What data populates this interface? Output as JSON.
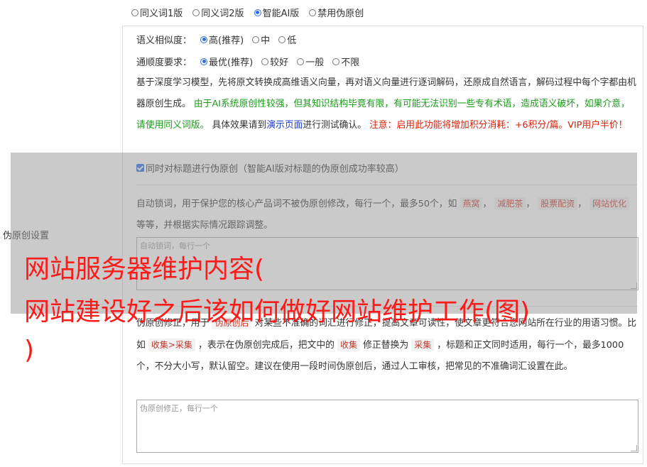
{
  "top_radios": [
    {
      "label": "同义词1版",
      "checked": false
    },
    {
      "label": "同义词2版",
      "checked": false
    },
    {
      "label": "智能AI版",
      "checked": true
    },
    {
      "label": "禁用伪原创",
      "checked": false
    }
  ],
  "side_label": "伪原创设置",
  "similarity": {
    "label": "语义相似度：",
    "options": [
      {
        "label": "高(推荐)",
        "checked": true
      },
      {
        "label": "中",
        "checked": false
      },
      {
        "label": "低",
        "checked": false
      }
    ]
  },
  "fluency": {
    "label": "通顺度要求：",
    "options": [
      {
        "label": "最优(推荐)",
        "checked": true
      },
      {
        "label": "较好",
        "checked": false
      },
      {
        "label": "一般",
        "checked": false
      },
      {
        "label": "不限",
        "checked": false
      }
    ]
  },
  "desc": {
    "p1": "基于深度学习模型，先将原文转换成高维语义向量，再对语义向量进行逐词解码，还原成自然语言，解码过程中每个字都由机器原创生成。",
    "green": "由于AI系统原创性较强，但其知识结构毕竟有限，有可能无法识别一些专有术语，造成语义破坏，如果介意，请使用同义词版。",
    "p2": "具体效果请到",
    "link": "演示页面",
    "p3": "进行测试确认。",
    "red": "注意：启用此功能将增加积分消耗：+6积分/篇。VIP用户半价！"
  },
  "title_checkbox": {
    "label": "同时对标题进行伪原创（智能AI版对标题的伪原创成功率较高）",
    "checked": true
  },
  "lock": {
    "text1": "自动锁词，用于保护您的核心产品词不被伪原创修改，每行一个，最多50个，如",
    "tags": [
      "燕窝",
      "减肥茶",
      "股票配资",
      "网站优化"
    ],
    "text2": "等等，并根据实际情况跟踪调整。",
    "placeholder": "自动锁词，每行一个"
  },
  "correction": {
    "t1": "伪原创修正，用于",
    "tag1": "伪原创后",
    "t2": "对某些不准确的词汇进行修正，提高文章可读性，使文章更符合您网站所在行业的用语习惯。比如",
    "tag2": "收集>采集",
    "t3": "，表示在伪原创完成后，把文中的",
    "tag3": "收集",
    "t4": "修正替换为",
    "tag4": "采集",
    "t5": "，标题和正文同时适用，每行一个，最多1000个，不分大小写，默认留空。建议在使用一段时间伪原创后，通过人工审核，把常见的不准确词汇设置在此。",
    "placeholder": "伪原创修正，每行一个"
  },
  "headline": {
    "line1": "网站服务器维护内容(",
    "line2": "网站建设好之后该如何做好网站维护工作(图)",
    "line3": ")"
  }
}
